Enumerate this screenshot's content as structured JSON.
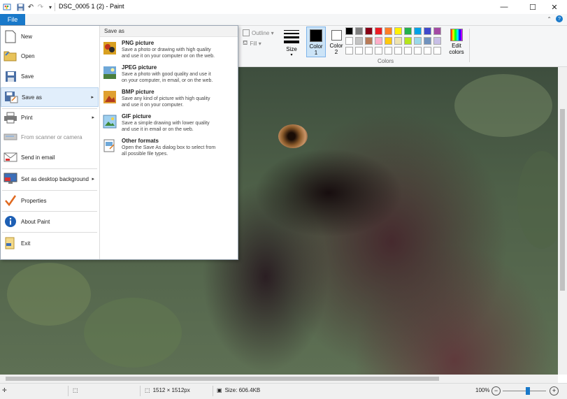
{
  "app": {
    "title": "DSC_0005 1 (2) - Paint",
    "file_tab": "File"
  },
  "window_controls": {
    "minimize": "—",
    "maximize": "☐",
    "close": "✕"
  },
  "ribbon": {
    "outline_label": "Outline ▾",
    "fill_label": "Fill ▾",
    "size_label": "Size",
    "color1_label": "Color 1",
    "color2_label": "Color 2",
    "edit_colors_label": "Edit colors",
    "colors_group_label": "Colors",
    "color1": "#000000",
    "color2": "#ffffff",
    "palette_row1": [
      "#000000",
      "#7f7f7f",
      "#880015",
      "#ed1c24",
      "#ff7f27",
      "#fff200",
      "#22b14c",
      "#00a2e8",
      "#3f48cc",
      "#a349a4"
    ],
    "palette_row2": [
      "#ffffff",
      "#c3c3c3",
      "#b97a57",
      "#ffaec9",
      "#ffc90e",
      "#efe4b0",
      "#b5e61d",
      "#99d9ea",
      "#7092be",
      "#c8bfe7"
    ],
    "palette_row3": [
      "#ffffff",
      "#ffffff",
      "#ffffff",
      "#ffffff",
      "#ffffff",
      "#ffffff",
      "#ffffff",
      "#ffffff",
      "#ffffff",
      "#ffffff"
    ]
  },
  "file_menu": {
    "items": [
      {
        "label": "New",
        "icon": "new-file-icon"
      },
      {
        "label": "Open",
        "icon": "open-folder-icon"
      },
      {
        "label": "Save",
        "icon": "save-disk-icon"
      },
      {
        "label": "Save as",
        "icon": "save-as-icon",
        "arrow": "▸"
      },
      {
        "label": "Print",
        "icon": "printer-icon",
        "arrow": "▸"
      },
      {
        "label": "From scanner or camera",
        "icon": "scanner-icon"
      },
      {
        "label": "Send in email",
        "icon": "email-icon"
      },
      {
        "label": "Set as desktop background",
        "icon": "desktop-icon",
        "arrow": "▸"
      },
      {
        "label": "Properties",
        "icon": "checkmark-icon"
      },
      {
        "label": "About Paint",
        "icon": "info-icon"
      },
      {
        "label": "Exit",
        "icon": "exit-icon"
      }
    ],
    "save_as": {
      "header": "Save as",
      "options": [
        {
          "title": "PNG picture",
          "desc1": "Save a photo or drawing with high quality",
          "desc2": "and use it on your computer or on the web."
        },
        {
          "title": "JPEG picture",
          "desc1": "Save a photo with good quality and use it",
          "desc2": "on your computer, in email, or on the web."
        },
        {
          "title": "BMP picture",
          "desc1": "Save any kind of picture with high quality",
          "desc2": "and use it on your computer."
        },
        {
          "title": "GIF picture",
          "desc1": "Save a simple drawing with lower quality",
          "desc2": "and use it in email or on the web."
        },
        {
          "title": "Other formats",
          "desc1": "Open the Save As dialog box to select from",
          "desc2": "all possible file types."
        }
      ]
    }
  },
  "status": {
    "dimensions": "1512 × 1512px",
    "size": "Size: 606.4KB",
    "zoom": "100%",
    "zoom_level": 0.58
  }
}
